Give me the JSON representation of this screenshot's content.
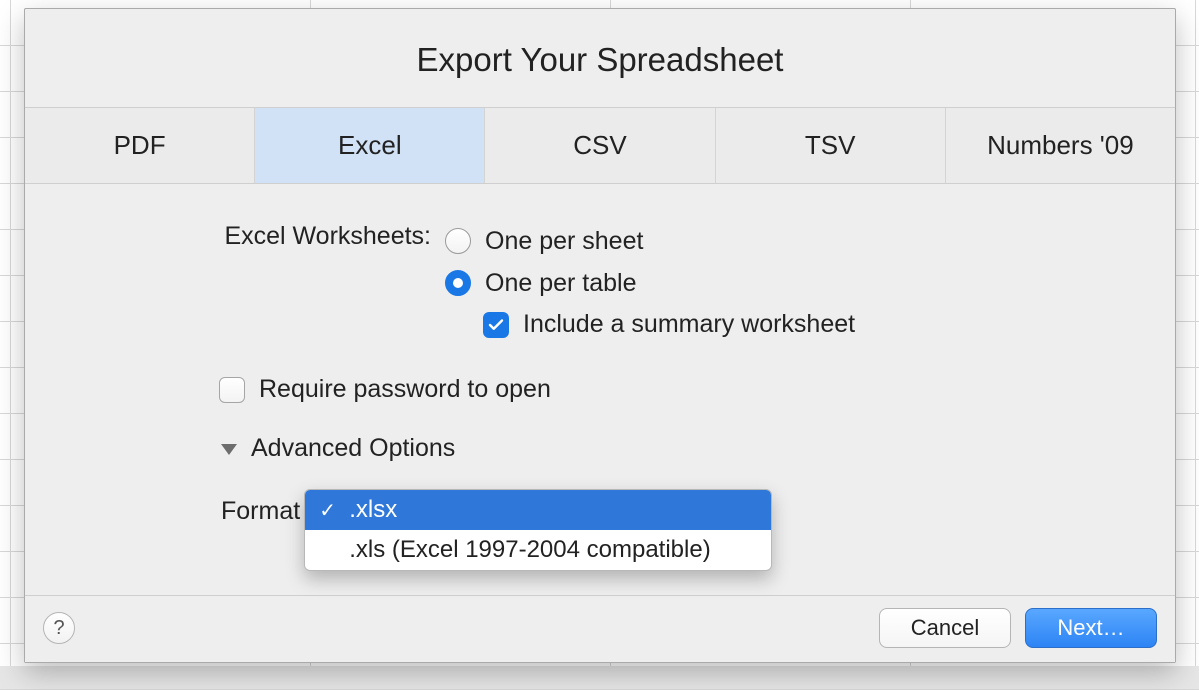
{
  "title": "Export Your Spreadsheet",
  "tabs": {
    "pdf": "PDF",
    "excel": "Excel",
    "csv": "CSV",
    "tsv": "TSV",
    "numbers09": "Numbers '09"
  },
  "worksheets": {
    "label": "Excel Worksheets:",
    "one_per_sheet": "One per sheet",
    "one_per_table": "One per table",
    "include_summary": "Include a summary worksheet"
  },
  "password": {
    "label": "Require password to open"
  },
  "advanced": {
    "label": "Advanced Options"
  },
  "format": {
    "label": "Format",
    "options": {
      "xlsx": ".xlsx",
      "xls": ".xls (Excel 1997-2004 compatible)"
    }
  },
  "footer": {
    "help": "?",
    "cancel": "Cancel",
    "next": "Next…"
  }
}
